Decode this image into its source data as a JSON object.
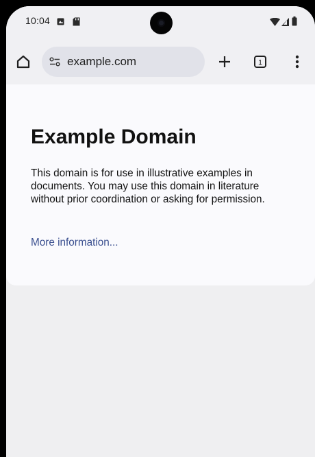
{
  "status_bar": {
    "time": "10:04",
    "left_icons": [
      "notification-icon",
      "sd-card-icon"
    ],
    "right_icons": [
      "wifi-icon",
      "signal-icon",
      "battery-icon"
    ]
  },
  "browser": {
    "url": "example.com",
    "tab_count": "1",
    "icons": [
      "home-icon",
      "site-settings-icon",
      "new-tab-icon",
      "tab-switcher-icon",
      "more-options-icon"
    ]
  },
  "page": {
    "title": "Example Domain",
    "paragraph": "This domain is for use in illustrative examples in documents. You may use this domain in literature without prior coordination or asking for permission.",
    "link_text": "More information..."
  },
  "colors": {
    "chrome_bg": "#f0f0f3",
    "url_pill": "#e1e2e9",
    "page_bg": "#fafafd",
    "link": "#3a4f8f"
  }
}
